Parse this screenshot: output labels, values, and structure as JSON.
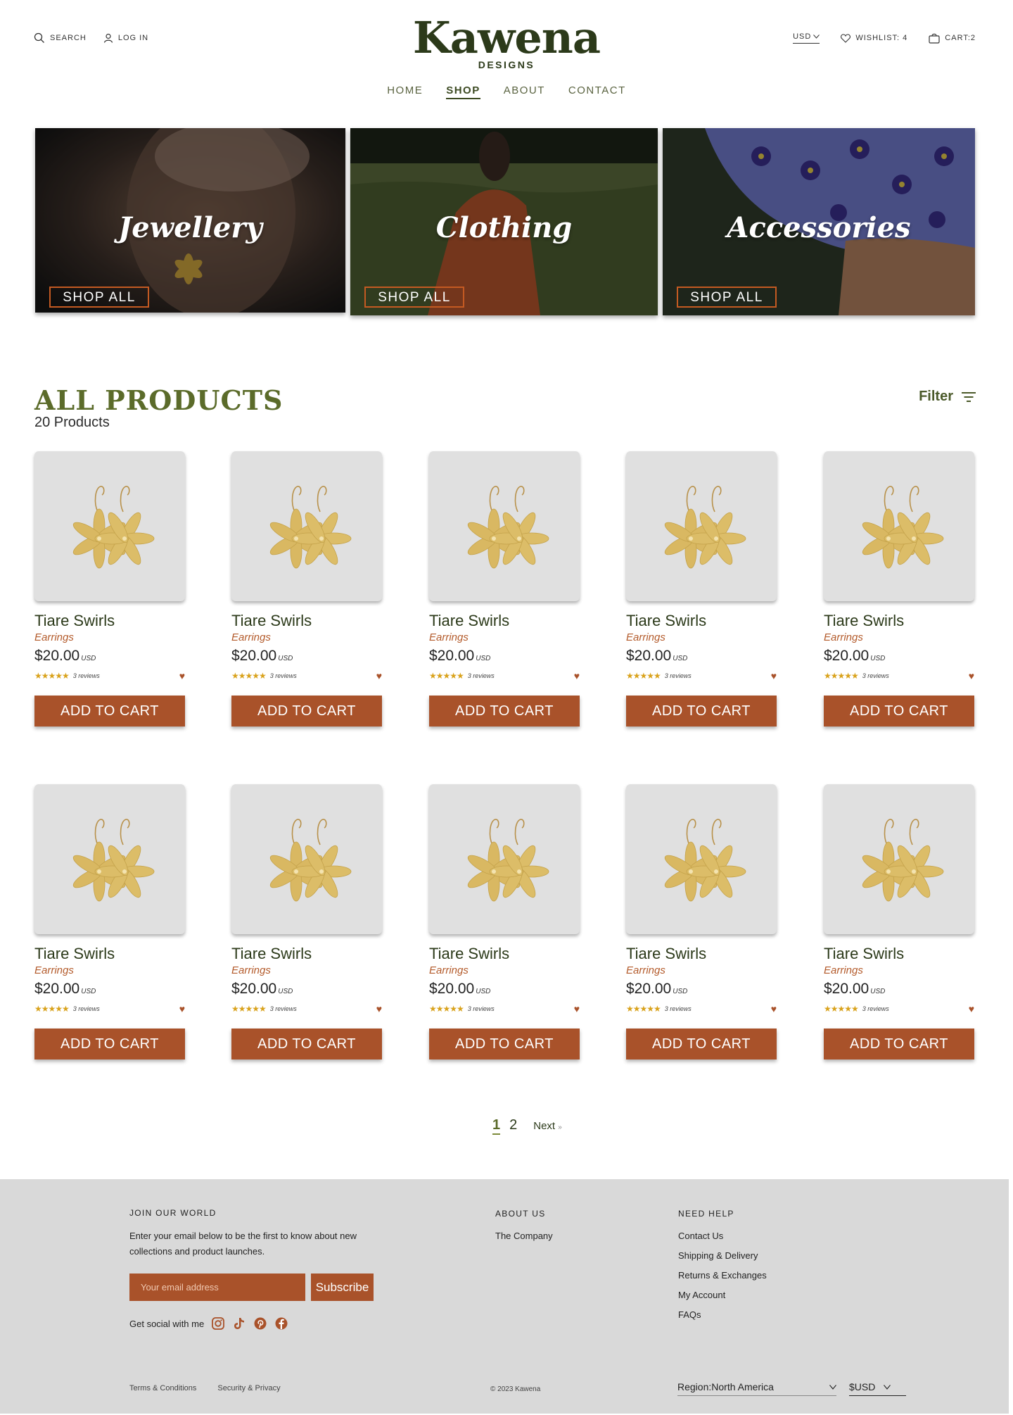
{
  "header": {
    "search_label": "SEARCH",
    "login_label": "LOG IN",
    "logo_main": "Kawena",
    "logo_sub": "DESIGNS",
    "currency_label": "USD",
    "wishlist_label": "WISHLIST: 4",
    "cart_label": "CART:2"
  },
  "nav": {
    "items": [
      {
        "label": "HOME",
        "active": false
      },
      {
        "label": "SHOP",
        "active": true
      },
      {
        "label": "ABOUT",
        "active": false
      },
      {
        "label": "CONTACT",
        "active": false
      }
    ]
  },
  "categories": [
    {
      "title": "Jewellery",
      "button": "SHOP ALL"
    },
    {
      "title": "Clothing",
      "button": "SHOP ALL"
    },
    {
      "title": "Accessories",
      "button": "SHOP ALL"
    }
  ],
  "products_section": {
    "title": "ALL PRODUCTS",
    "count": "20 Products",
    "filter_label": "Filter"
  },
  "products": [
    {
      "name": "Tiare Swirls",
      "category": "Earrings",
      "price": "$20.00",
      "currency": "USD",
      "rating": 5,
      "reviews": "3 reviews",
      "button": "ADD TO CART"
    },
    {
      "name": "Tiare Swirls",
      "category": "Earrings",
      "price": "$20.00",
      "currency": "USD",
      "rating": 5,
      "reviews": "3 reviews",
      "button": "ADD TO CART"
    },
    {
      "name": "Tiare Swirls",
      "category": "Earrings",
      "price": "$20.00",
      "currency": "USD",
      "rating": 5,
      "reviews": "3 reviews",
      "button": "ADD TO CART"
    },
    {
      "name": "Tiare Swirls",
      "category": "Earrings",
      "price": "$20.00",
      "currency": "USD",
      "rating": 5,
      "reviews": "3 reviews",
      "button": "ADD TO CART"
    },
    {
      "name": "Tiare Swirls",
      "category": "Earrings",
      "price": "$20.00",
      "currency": "USD",
      "rating": 5,
      "reviews": "3 reviews",
      "button": "ADD TO CART"
    },
    {
      "name": "Tiare Swirls",
      "category": "Earrings",
      "price": "$20.00",
      "currency": "USD",
      "rating": 5,
      "reviews": "3 reviews",
      "button": "ADD TO CART"
    },
    {
      "name": "Tiare Swirls",
      "category": "Earrings",
      "price": "$20.00",
      "currency": "USD",
      "rating": 5,
      "reviews": "3 reviews",
      "button": "ADD TO CART"
    },
    {
      "name": "Tiare Swirls",
      "category": "Earrings",
      "price": "$20.00",
      "currency": "USD",
      "rating": 5,
      "reviews": "3 reviews",
      "button": "ADD TO CART"
    },
    {
      "name": "Tiare Swirls",
      "category": "Earrings",
      "price": "$20.00",
      "currency": "USD",
      "rating": 5,
      "reviews": "3 reviews",
      "button": "ADD TO CART"
    },
    {
      "name": "Tiare Swirls",
      "category": "Earrings",
      "price": "$20.00",
      "currency": "USD",
      "rating": 5,
      "reviews": "3 reviews",
      "button": "ADD TO CART"
    }
  ],
  "pagination": {
    "pages": [
      "1",
      "2"
    ],
    "current": "1",
    "next_label": "Next"
  },
  "footer": {
    "join_heading": "JOIN OUR WORLD",
    "join_text": "Enter your email below to be the first to know about new collections and product launches.",
    "email_placeholder": "Your email address",
    "subscribe_label": "Subscribe",
    "social_label": "Get social with me",
    "social_icons": [
      "instagram-icon",
      "tiktok-icon",
      "pinterest-icon",
      "facebook-icon"
    ],
    "about_heading": "ABOUT US",
    "about_links": [
      "The Company"
    ],
    "help_heading": "NEED HELP",
    "help_links": [
      "Contact Us",
      "Shipping & Delivery",
      "Returns & Exchanges",
      "My Account",
      "FAQs"
    ],
    "terms_label": "Terms & Conditions",
    "privacy_label": "Security & Privacy",
    "copyright": "© 2023 Kawena",
    "region_label": "Region:North America",
    "currency_label": "$USD"
  },
  "colors": {
    "brand_dark": "#2c3a1a",
    "olive": "#5b6b2a",
    "accent": "#a9522a",
    "star": "#d9a21b",
    "footer_bg": "#d9d9d9"
  }
}
